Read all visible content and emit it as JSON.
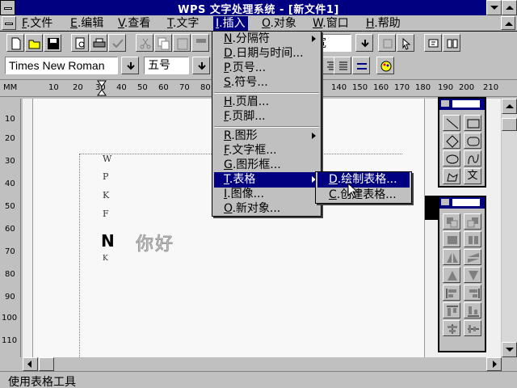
{
  "window": {
    "title": "WPS 文字处理系统 - [新文件1]"
  },
  "menubar": {
    "items": [
      {
        "key": "F",
        "label": ".文件",
        "active": false
      },
      {
        "key": "E",
        "label": ".编辑",
        "active": false
      },
      {
        "key": "V",
        "label": ".查看",
        "active": false
      },
      {
        "key": "T",
        "label": ".文字",
        "active": false
      },
      {
        "key": "I",
        "label": ".插入",
        "active": true
      },
      {
        "key": "O",
        "label": ".对象",
        "active": false
      },
      {
        "key": "W",
        "label": ".窗口",
        "active": false
      },
      {
        "key": "H",
        "label": ".帮助",
        "active": false
      }
    ]
  },
  "toolbar": {
    "width_partial_label": "宽"
  },
  "formatbar": {
    "font_name": "Times New Roman",
    "font_size": "五号"
  },
  "ruler": {
    "unit": "MM",
    "ticks": [
      "10",
      "20",
      "30",
      "40",
      "50",
      "60",
      "70",
      "80",
      "140",
      "150",
      "160",
      "170",
      "180",
      "190",
      "200",
      "210"
    ]
  },
  "vruler": {
    "ticks": [
      "10",
      "20",
      "30",
      "40",
      "50",
      "60",
      "70",
      "80",
      "90",
      "100",
      "110"
    ]
  },
  "insert_menu": {
    "items": [
      {
        "key": "N",
        "label": ".分隔符",
        "submenu": true
      },
      {
        "key": "D",
        "label": ".日期与时间...",
        "submenu": false
      },
      {
        "key": "P",
        "label": ".页号...",
        "submenu": false
      },
      {
        "key": "S",
        "label": ".符号...",
        "submenu": false
      },
      {
        "key": "H",
        "label": ".页眉...",
        "submenu": false
      },
      {
        "key": "F",
        "label": ".页脚...",
        "submenu": false
      },
      {
        "key": "R",
        "label": ".图形",
        "submenu": true
      },
      {
        "key": "F",
        "label": ".文字框...",
        "submenu": false
      },
      {
        "key": "G",
        "label": ".图形框...",
        "submenu": false
      },
      {
        "key": "T",
        "label": ".表格",
        "submenu": true,
        "selected": true
      },
      {
        "key": "I",
        "label": ".图像...",
        "submenu": false
      },
      {
        "key": "O",
        "label": ".新对象...",
        "submenu": false
      }
    ]
  },
  "table_submenu": {
    "items": [
      {
        "key": "D",
        "label": ".绘制表格...",
        "selected": true
      },
      {
        "key": "C",
        "label": ".创建表格...",
        "selected": false
      }
    ]
  },
  "document": {
    "side_letters": [
      "W",
      "P",
      "K",
      "F"
    ],
    "big_letter": "N",
    "small_letter": "K",
    "chinese_text": "你好"
  },
  "palette_draw": {
    "text_tool": "文"
  },
  "statusbar": {
    "message": "使用表格工具"
  }
}
